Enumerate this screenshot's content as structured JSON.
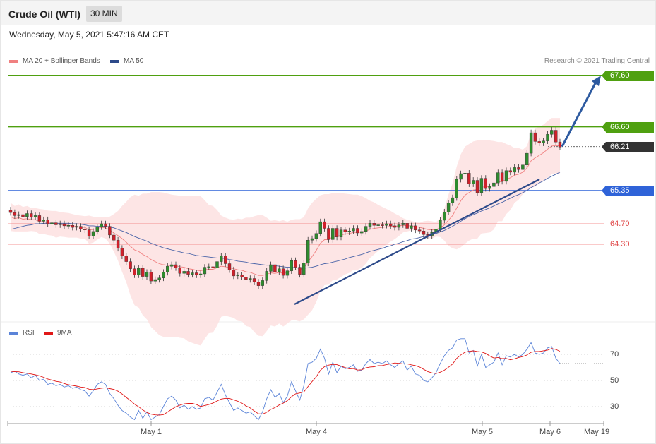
{
  "header": {
    "title": "Crude Oil (WTI)",
    "interval": "30 MIN"
  },
  "datetime": "Wednesday, May 5, 2021 5:47:16 AM CET",
  "legend": {
    "ma20_label": "MA 20 + Bollinger Bands",
    "ma50_label": "MA 50",
    "rsi_label": "RSI",
    "rsi_ma_label": "9MA",
    "credit": "Research © 2021 Trading Central"
  },
  "colors": {
    "bull": "#2e8b2e",
    "bear": "#d0202a",
    "band": "#fde0e0",
    "ma20": "#f08080",
    "ma50": "#4a64a8",
    "resistance": "#4fa010",
    "support": "#2f63d8",
    "level": "#f07070",
    "trend": "#2d4a8a",
    "rsi": "#5b84d8",
    "rsi_ma": "#e01818",
    "current": "#333333"
  },
  "levels": [
    {
      "value": "67.60",
      "kind": "resistance"
    },
    {
      "value": "66.60",
      "kind": "resistance"
    },
    {
      "value": "66.21",
      "kind": "current"
    },
    {
      "value": "65.35",
      "kind": "support"
    },
    {
      "value": "64.70",
      "kind": "level"
    },
    {
      "value": "64.30",
      "kind": "level"
    }
  ],
  "rsi_ticks": [
    "70",
    "50",
    "30"
  ],
  "x_labels": [
    "May 1",
    "May 4",
    "May 5",
    "May 6",
    "May 19"
  ],
  "chart_data": [
    {
      "type": "candlestick",
      "title": "Crude Oil (WTI)",
      "interval": "30 MIN",
      "ylim": [
        63.15,
        67.75
      ],
      "last": 66.21,
      "x_labels": [
        "May 1",
        "May 4",
        "May 5",
        "May 6",
        "May 19"
      ],
      "close": [
        64.92,
        64.86,
        64.88,
        64.84,
        64.9,
        64.83,
        64.86,
        64.75,
        64.78,
        64.7,
        64.72,
        64.68,
        64.7,
        64.66,
        64.67,
        64.63,
        64.65,
        64.6,
        64.58,
        64.46,
        64.55,
        64.64,
        64.7,
        64.65,
        64.48,
        64.38,
        64.22,
        64.07,
        63.96,
        63.82,
        63.7,
        63.83,
        63.67,
        63.75,
        63.58,
        63.61,
        63.64,
        63.75,
        63.87,
        63.9,
        63.84,
        63.73,
        63.77,
        63.71,
        63.74,
        63.7,
        63.72,
        63.85,
        63.86,
        63.84,
        63.96,
        64.07,
        63.92,
        63.8,
        63.68,
        63.7,
        63.66,
        63.61,
        63.63,
        63.56,
        63.49,
        63.59,
        63.77,
        63.9,
        63.76,
        63.82,
        63.69,
        63.78,
        63.98,
        63.85,
        63.71,
        63.93,
        64.38,
        64.41,
        64.51,
        64.74,
        64.61,
        64.39,
        64.61,
        64.44,
        64.58,
        64.54,
        64.56,
        64.61,
        64.52,
        64.55,
        64.65,
        64.71,
        64.67,
        64.68,
        64.67,
        64.7,
        64.66,
        64.63,
        64.68,
        64.71,
        64.61,
        64.66,
        64.58,
        64.56,
        64.49,
        64.47,
        64.53,
        64.6,
        64.77,
        64.93,
        65.11,
        65.21,
        65.57,
        65.68,
        65.69,
        65.48,
        65.55,
        65.31,
        65.59,
        65.39,
        65.43,
        65.5,
        65.7,
        65.53,
        65.74,
        65.71,
        65.8,
        65.76,
        65.85,
        66.08,
        66.48,
        66.31,
        66.28,
        66.32,
        66.45,
        66.53,
        66.3,
        66.2
      ],
      "ma20": [
        64.84,
        64.8,
        64.82,
        64.79,
        64.8,
        64.78,
        64.78,
        64.74,
        64.74,
        64.72,
        64.71,
        64.69,
        64.69,
        64.68,
        64.67,
        64.66,
        64.65,
        64.63,
        64.63,
        64.58,
        64.59,
        64.61,
        64.63,
        64.62,
        64.58,
        64.52,
        64.47,
        64.41,
        64.34,
        64.26,
        64.19,
        64.16,
        64.1,
        64.06,
        64.0,
        63.96,
        63.92,
        63.9,
        63.89,
        63.88,
        63.88,
        63.86,
        63.85,
        63.82,
        63.81,
        63.79,
        63.78,
        63.8,
        63.81,
        63.81,
        63.84,
        63.87,
        63.86,
        63.84,
        63.82,
        63.8,
        63.79,
        63.76,
        63.75,
        63.72,
        63.69,
        63.69,
        63.71,
        63.74,
        63.73,
        63.75,
        63.73,
        63.74,
        63.79,
        63.8,
        63.79,
        63.83,
        63.96,
        64.06,
        64.18,
        64.32,
        64.39,
        64.39,
        64.45,
        64.45,
        64.48,
        64.5,
        64.51,
        64.53,
        64.53,
        64.54,
        64.56,
        64.59,
        64.61,
        64.62,
        64.63,
        64.64,
        64.65,
        64.65,
        64.66,
        64.67,
        64.66,
        64.66,
        64.65,
        64.63,
        64.61,
        64.59,
        64.58,
        64.59,
        64.62,
        64.68,
        64.77,
        64.86,
        65.01,
        65.15,
        65.26,
        65.31,
        65.36,
        65.37,
        65.42,
        65.42,
        65.43,
        65.45,
        65.52,
        65.52,
        65.57,
        65.6,
        65.65,
        65.67,
        65.71,
        65.79,
        65.93,
        65.99,
        66.04,
        66.09,
        66.16,
        66.22,
        66.23,
        66.22
      ],
      "ma50": [
        64.59,
        64.61,
        64.63,
        64.65,
        64.67,
        64.68,
        64.7,
        64.7,
        64.71,
        64.71,
        64.71,
        64.71,
        64.71,
        64.71,
        64.71,
        64.7,
        64.7,
        64.69,
        64.68,
        64.66,
        64.66,
        64.65,
        64.65,
        64.65,
        64.64,
        64.62,
        64.59,
        64.56,
        64.53,
        64.49,
        64.45,
        64.42,
        64.39,
        64.36,
        64.32,
        64.29,
        64.26,
        64.23,
        64.21,
        64.19,
        64.17,
        64.15,
        64.13,
        64.12,
        64.1,
        64.08,
        64.07,
        64.06,
        64.05,
        64.04,
        64.03,
        64.03,
        64.02,
        64.0,
        63.99,
        63.97,
        63.96,
        63.95,
        63.93,
        63.92,
        63.91,
        63.9,
        63.89,
        63.89,
        63.88,
        63.87,
        63.86,
        63.85,
        63.85,
        63.84,
        63.83,
        63.83,
        63.84,
        63.85,
        63.87,
        63.9,
        63.92,
        63.93,
        63.95,
        63.97,
        63.99,
        64.01,
        64.04,
        64.06,
        64.08,
        64.1,
        64.13,
        64.16,
        64.18,
        64.2,
        64.22,
        64.25,
        64.27,
        64.3,
        64.32,
        64.35,
        64.37,
        64.4,
        64.41,
        64.43,
        64.45,
        64.47,
        64.49,
        64.51,
        64.54,
        64.57,
        64.61,
        64.65,
        64.7,
        64.75,
        64.8,
        64.84,
        64.88,
        64.91,
        64.95,
        64.98,
        65.01,
        65.05,
        65.09,
        65.12,
        65.16,
        65.2,
        65.24,
        65.27,
        65.31,
        65.35,
        65.41,
        65.45,
        65.5,
        65.54,
        65.59,
        65.63,
        65.67,
        65.71
      ],
      "bollinger_upper": [
        65.11,
        65.05,
        65.08,
        65.03,
        65.05,
        65.01,
        65.01,
        64.99,
        64.98,
        64.96,
        64.95,
        64.95,
        64.93,
        64.92,
        64.91,
        64.89,
        64.87,
        64.86,
        64.85,
        64.86,
        64.84,
        64.83,
        64.83,
        64.83,
        64.84,
        64.89,
        64.95,
        65.05,
        65.13,
        65.22,
        65.27,
        65.25,
        65.29,
        65.29,
        65.32,
        65.32,
        65.32,
        65.31,
        65.29,
        65.27,
        65.26,
        65.25,
        65.24,
        65.25,
        65.25,
        65.25,
        65.24,
        65.16,
        65.07,
        65.05,
        64.97,
        64.86,
        64.82,
        64.79,
        64.78,
        64.8,
        64.79,
        64.82,
        64.82,
        64.85,
        64.87,
        64.87,
        64.82,
        64.76,
        64.77,
        64.75,
        64.77,
        64.74,
        64.78,
        64.79,
        64.79,
        64.83,
        65.0,
        65.11,
        65.19,
        65.26,
        65.28,
        65.28,
        65.3,
        65.3,
        65.3,
        65.29,
        65.28,
        65.27,
        65.27,
        65.24,
        65.2,
        65.15,
        65.12,
        65.07,
        65.03,
        64.99,
        64.95,
        64.9,
        64.86,
        64.81,
        64.78,
        64.76,
        64.73,
        64.72,
        64.75,
        64.76,
        64.75,
        64.73,
        64.81,
        65.0,
        65.27,
        65.49,
        65.82,
        66.06,
        66.21,
        66.26,
        66.31,
        66.33,
        66.33,
        66.33,
        66.33,
        66.32,
        66.3,
        66.3,
        66.26,
        66.23,
        66.18,
        66.18,
        66.15,
        66.22,
        66.47,
        66.56,
        66.6,
        66.64,
        66.71,
        66.77,
        66.77,
        66.77
      ],
      "bollinger_lower": [
        64.56,
        64.55,
        64.55,
        64.55,
        64.55,
        64.56,
        64.55,
        64.5,
        64.5,
        64.48,
        64.47,
        64.43,
        64.45,
        64.44,
        64.43,
        64.43,
        64.43,
        64.41,
        64.41,
        64.31,
        64.33,
        64.39,
        64.44,
        64.41,
        64.31,
        64.15,
        63.98,
        63.76,
        63.56,
        63.3,
        63.11,
        63.06,
        62.91,
        62.83,
        62.68,
        62.6,
        62.52,
        62.49,
        62.48,
        62.49,
        62.49,
        62.47,
        62.46,
        62.4,
        62.37,
        62.34,
        62.32,
        62.45,
        62.56,
        62.57,
        62.71,
        62.88,
        62.9,
        62.88,
        62.86,
        62.8,
        62.79,
        62.7,
        62.68,
        62.58,
        62.51,
        62.5,
        62.6,
        62.71,
        62.69,
        62.75,
        62.69,
        62.75,
        62.81,
        62.81,
        62.79,
        62.83,
        62.92,
        63.01,
        63.17,
        63.38,
        63.5,
        63.51,
        63.6,
        63.61,
        63.66,
        63.71,
        63.74,
        63.8,
        63.8,
        63.84,
        63.92,
        64.03,
        64.1,
        64.17,
        64.23,
        64.3,
        64.35,
        64.4,
        64.46,
        64.53,
        64.55,
        64.57,
        64.57,
        64.54,
        64.46,
        64.42,
        64.41,
        64.45,
        64.44,
        64.37,
        64.27,
        64.22,
        64.2,
        64.24,
        64.31,
        64.37,
        64.41,
        64.41,
        64.51,
        64.52,
        64.53,
        64.59,
        64.75,
        64.75,
        64.89,
        64.97,
        65.11,
        65.17,
        65.28,
        65.36,
        65.4,
        65.43,
        65.49,
        65.55,
        65.6,
        65.67,
        65.69,
        65.68
      ],
      "annotations": [
        "trend-line support",
        "projected move to 67.60"
      ]
    },
    {
      "type": "line",
      "title": "RSI",
      "ylim": [
        20,
        80
      ],
      "reference_levels": [
        70,
        50,
        30
      ],
      "series": [
        {
          "name": "RSI",
          "values": [
            56,
            57,
            55,
            54,
            55,
            52,
            54,
            50,
            51,
            47,
            48,
            46,
            47,
            45,
            46,
            44,
            45,
            43,
            42,
            38,
            42,
            47,
            49,
            47,
            40,
            36,
            31,
            27,
            25,
            22,
            20,
            27,
            21,
            26,
            20,
            22,
            24,
            30,
            36,
            38,
            35,
            29,
            31,
            28,
            30,
            28,
            29,
            36,
            37,
            35,
            41,
            47,
            39,
            33,
            27,
            29,
            27,
            25,
            26,
            23,
            20,
            26,
            36,
            43,
            37,
            40,
            33,
            38,
            49,
            42,
            35,
            46,
            63,
            64,
            67,
            74,
            67,
            55,
            64,
            56,
            61,
            59,
            60,
            62,
            57,
            58,
            63,
            66,
            63,
            64,
            63,
            65,
            62,
            60,
            63,
            65,
            58,
            61,
            55,
            54,
            50,
            49,
            52,
            56,
            63,
            69,
            73,
            75,
            81,
            82,
            82,
            71,
            73,
            61,
            70,
            60,
            62,
            64,
            71,
            62,
            69,
            68,
            70,
            68,
            70,
            74,
            79,
            71,
            70,
            71,
            75,
            76,
            67,
            63
          ]
        },
        {
          "name": "9MA",
          "values": [
            57.0,
            56.75,
            56.67,
            56.0,
            55.5,
            55.0,
            54.33,
            53.56,
            52.44,
            51.11,
            50.33,
            49.33,
            48.89,
            47.67,
            46.78,
            46.22,
            45.67,
            45.0,
            44.67,
            43.33,
            43.0,
            43.56,
            44.11,
            44.44,
            43.78,
            43.11,
            41.78,
            39.67,
            37.0,
            34.67,
            31.89,
            29.89,
            27.44,
            25.56,
            24.22,
            23.67,
            23.44,
            23.89,
            25.78,
            27.89,
            29.89,
            31.11,
            32.11,
            32.44,
            32.44,
            31.56,
            30.11,
            30.89,
            31.56,
            32.78,
            34.33,
            35.78,
            36.33,
            36.22,
            35.11,
            34.11,
            32.67,
            30.56,
            29.0,
            26.67,
            24.56,
            24.33,
            25.67,
            27.89,
            29.22,
            31.22,
            32.67,
            34.56,
            37.56,
            39.78,
            40.44,
            41.22,
            45.33,
            49.22,
            52.89,
            57.78,
            60.67,
            61.78,
            62.33,
            62.11,
            61.0,
            59.89,
            58.89,
            59.11,
            58.0,
            58.22,
            59.67,
            60.33,
            60.56,
            61.33,
            61.44,
            62.22,
            62.67,
            63.4,
            63.11,
            62.78,
            62.78,
            62.0,
            61.38,
            60.35,
            58.54,
            56.81,
            55.86,
            55.3,
            56.31,
            57.9,
            60.09,
            62.58,
            67.0,
            69.57,
            71.7,
            72.33,
            72.71,
            72.19,
            71.84,
            70.7,
            68.74,
            67.19,
            67.6,
            66.76,
            66.87,
            65.87,
            66.62,
            67.62,
            68.33,
            69.52,
            71.63,
            72.17,
            72.23,
            72.75,
            73.26,
            74.48,
            73.8,
            72.39
          ]
        }
      ]
    }
  ]
}
